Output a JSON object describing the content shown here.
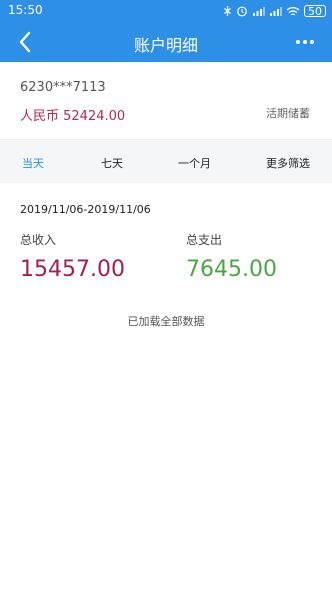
{
  "status": {
    "time": "15:50",
    "battery": "50"
  },
  "header": {
    "title": "账户明细"
  },
  "account": {
    "number": "6230***7113",
    "balance": "人民币 52424.00",
    "type": "活期储蓄"
  },
  "filters": {
    "tabs": [
      "当天",
      "七天",
      "一个月",
      "更多筛选"
    ],
    "active": "当天"
  },
  "summary": {
    "date_range": "2019/11/06-2019/11/06",
    "income_label": "总收入",
    "income_value": "15457.00",
    "expense_label": "总支出",
    "expense_value": "7645.00",
    "loaded_note": "已加载全部数据"
  },
  "colors": {
    "brand": "#2e8fe6",
    "income": "#a61d56",
    "expense": "#4aa843",
    "balance": "#b5275a"
  }
}
